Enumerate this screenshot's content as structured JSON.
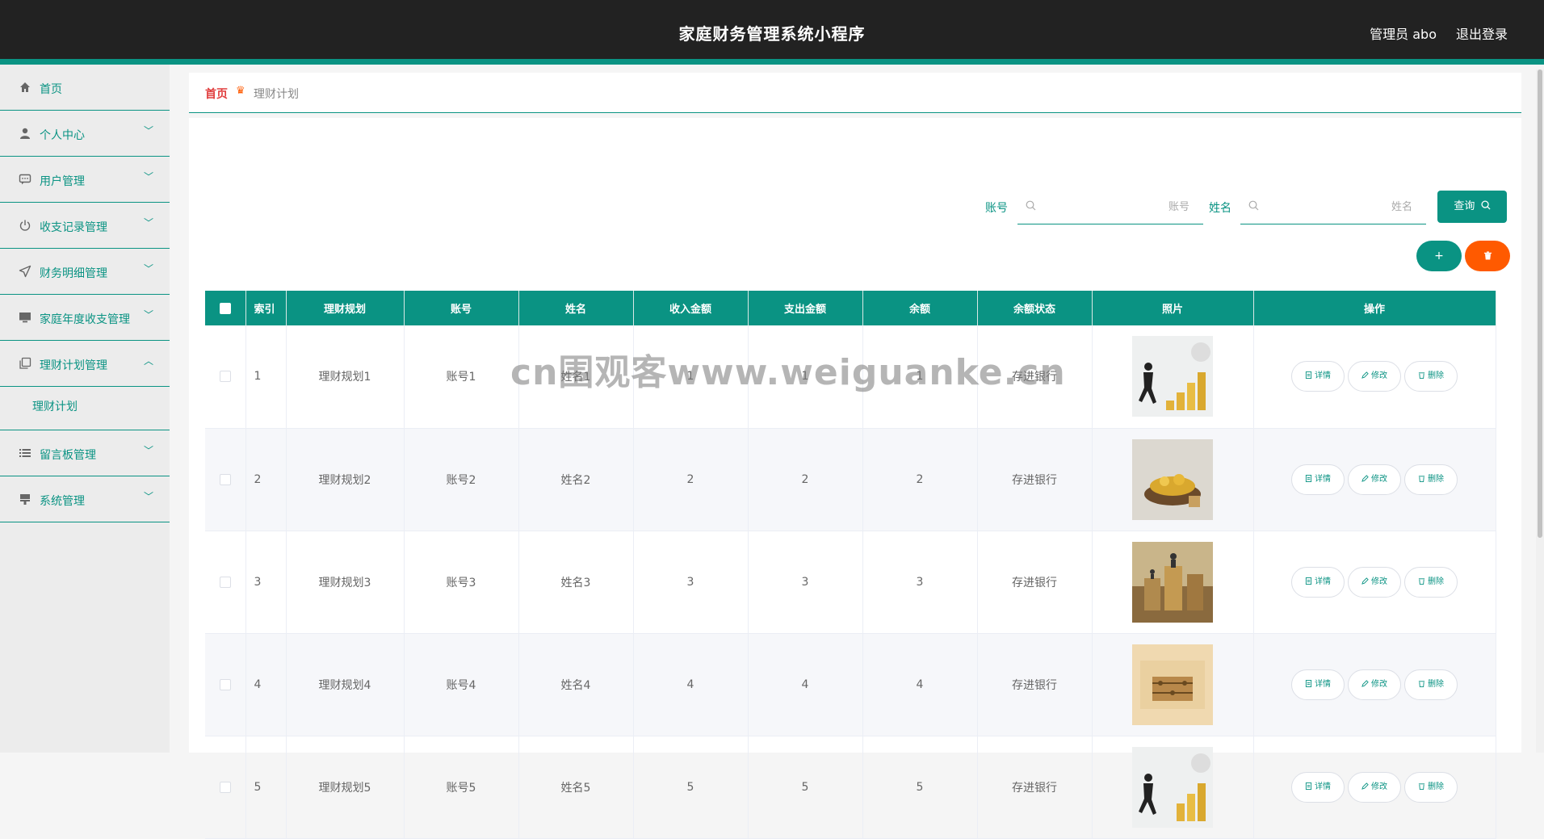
{
  "header": {
    "title": "家庭财务管理系统小程序",
    "user": "管理员 abo",
    "logout": "退出登录"
  },
  "sidebar": {
    "items": [
      {
        "label": "首页",
        "icon": "home-icon"
      },
      {
        "label": "个人中心",
        "icon": "user-icon"
      },
      {
        "label": "用户管理",
        "icon": "chat-icon"
      },
      {
        "label": "收支记录管理",
        "icon": "power-icon"
      },
      {
        "label": "财务明细管理",
        "icon": "send-icon"
      },
      {
        "label": "家庭年度收支管理",
        "icon": "monitor-icon"
      },
      {
        "label": "理财计划管理",
        "icon": "copy-icon"
      },
      {
        "label": "留言板管理",
        "icon": "list-icon"
      },
      {
        "label": "系统管理",
        "icon": "stamp-icon"
      }
    ],
    "submenu": "理财计划"
  },
  "breadcrumb": {
    "home": "首页",
    "current": "理财计划"
  },
  "search": {
    "account_label": "账号",
    "account_placeholder": "账号",
    "name_label": "姓名",
    "name_placeholder": "姓名",
    "query_label": "查询"
  },
  "actions": {
    "add": "+",
    "delete_icon": "trash-icon"
  },
  "table": {
    "headers": [
      "索引",
      "理财规划",
      "账号",
      "姓名",
      "收入金额",
      "支出金额",
      "余额",
      "余额状态",
      "照片",
      "操作"
    ],
    "rows": [
      {
        "index": "1",
        "plan": "理财规划1",
        "account": "账号1",
        "name": "姓名1",
        "income": "1",
        "expense": "1",
        "balance": "1",
        "status": "存进银行"
      },
      {
        "index": "2",
        "plan": "理财规划2",
        "account": "账号2",
        "name": "姓名2",
        "income": "2",
        "expense": "2",
        "balance": "2",
        "status": "存进银行"
      },
      {
        "index": "3",
        "plan": "理财规划3",
        "account": "账号3",
        "name": "姓名3",
        "income": "3",
        "expense": "3",
        "balance": "3",
        "status": "存进银行"
      },
      {
        "index": "4",
        "plan": "理财规划4",
        "account": "账号4",
        "name": "姓名4",
        "income": "4",
        "expense": "4",
        "balance": "4",
        "status": "存进银行"
      },
      {
        "index": "5",
        "plan": "理财规划5",
        "account": "账号5",
        "name": "姓名5",
        "income": "5",
        "expense": "5",
        "balance": "5",
        "status": "存进银行"
      }
    ],
    "row_actions": {
      "detail": "详情",
      "edit": "修改",
      "delete": "删除"
    }
  },
  "watermark": "cn围观客www.weiguanke.cn",
  "colors": {
    "primary": "#0a9383",
    "danger": "#ff5a00",
    "header": "#222222"
  }
}
